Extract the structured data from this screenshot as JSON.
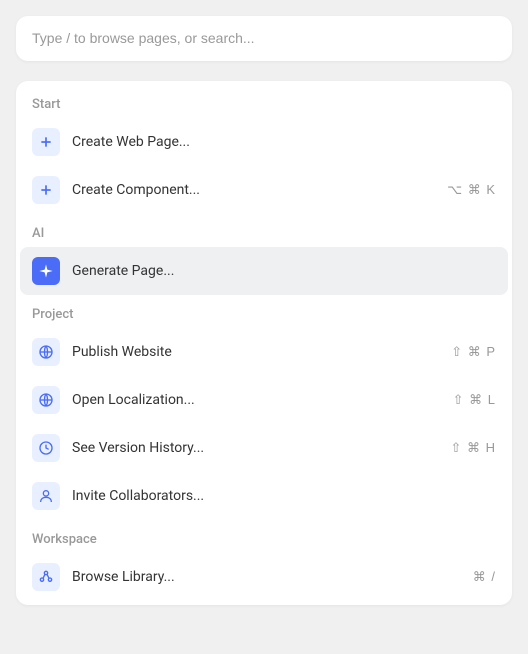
{
  "search": {
    "placeholder": "Type / to browse pages, or search..."
  },
  "sections": {
    "start": {
      "header": "Start",
      "items": [
        {
          "label": "Create Web Page...",
          "shortcut": ""
        },
        {
          "label": "Create Component...",
          "shortcut": "⌥ ⌘ K"
        }
      ]
    },
    "ai": {
      "header": "AI",
      "items": [
        {
          "label": "Generate Page...",
          "shortcut": ""
        }
      ]
    },
    "project": {
      "header": "Project",
      "items": [
        {
          "label": "Publish Website",
          "shortcut": "⇧ ⌘ P"
        },
        {
          "label": "Open Localization...",
          "shortcut": "⇧ ⌘ L"
        },
        {
          "label": "See Version History...",
          "shortcut": "⇧ ⌘ H"
        },
        {
          "label": "Invite Collaborators...",
          "shortcut": ""
        }
      ]
    },
    "workspace": {
      "header": "Workspace",
      "items": [
        {
          "label": "Browse Library...",
          "shortcut": "⌘ /"
        }
      ]
    }
  }
}
